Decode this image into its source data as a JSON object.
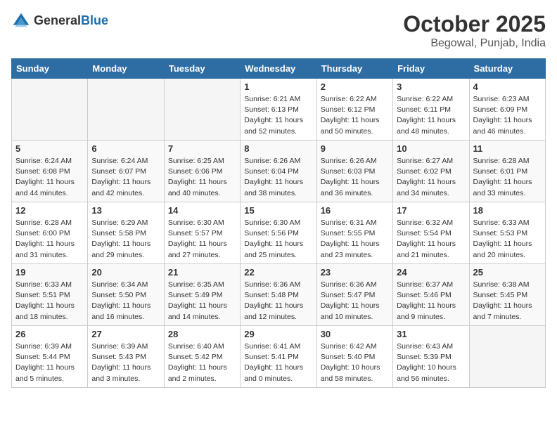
{
  "header": {
    "logo_general": "General",
    "logo_blue": "Blue",
    "month": "October 2025",
    "location": "Begowal, Punjab, India"
  },
  "days_of_week": [
    "Sunday",
    "Monday",
    "Tuesday",
    "Wednesday",
    "Thursday",
    "Friday",
    "Saturday"
  ],
  "weeks": [
    [
      {
        "day": "",
        "info": ""
      },
      {
        "day": "",
        "info": ""
      },
      {
        "day": "",
        "info": ""
      },
      {
        "day": "1",
        "info": "Sunrise: 6:21 AM\nSunset: 6:13 PM\nDaylight: 11 hours\nand 52 minutes."
      },
      {
        "day": "2",
        "info": "Sunrise: 6:22 AM\nSunset: 6:12 PM\nDaylight: 11 hours\nand 50 minutes."
      },
      {
        "day": "3",
        "info": "Sunrise: 6:22 AM\nSunset: 6:11 PM\nDaylight: 11 hours\nand 48 minutes."
      },
      {
        "day": "4",
        "info": "Sunrise: 6:23 AM\nSunset: 6:09 PM\nDaylight: 11 hours\nand 46 minutes."
      }
    ],
    [
      {
        "day": "5",
        "info": "Sunrise: 6:24 AM\nSunset: 6:08 PM\nDaylight: 11 hours\nand 44 minutes."
      },
      {
        "day": "6",
        "info": "Sunrise: 6:24 AM\nSunset: 6:07 PM\nDaylight: 11 hours\nand 42 minutes."
      },
      {
        "day": "7",
        "info": "Sunrise: 6:25 AM\nSunset: 6:06 PM\nDaylight: 11 hours\nand 40 minutes."
      },
      {
        "day": "8",
        "info": "Sunrise: 6:26 AM\nSunset: 6:04 PM\nDaylight: 11 hours\nand 38 minutes."
      },
      {
        "day": "9",
        "info": "Sunrise: 6:26 AM\nSunset: 6:03 PM\nDaylight: 11 hours\nand 36 minutes."
      },
      {
        "day": "10",
        "info": "Sunrise: 6:27 AM\nSunset: 6:02 PM\nDaylight: 11 hours\nand 34 minutes."
      },
      {
        "day": "11",
        "info": "Sunrise: 6:28 AM\nSunset: 6:01 PM\nDaylight: 11 hours\nand 33 minutes."
      }
    ],
    [
      {
        "day": "12",
        "info": "Sunrise: 6:28 AM\nSunset: 6:00 PM\nDaylight: 11 hours\nand 31 minutes."
      },
      {
        "day": "13",
        "info": "Sunrise: 6:29 AM\nSunset: 5:58 PM\nDaylight: 11 hours\nand 29 minutes."
      },
      {
        "day": "14",
        "info": "Sunrise: 6:30 AM\nSunset: 5:57 PM\nDaylight: 11 hours\nand 27 minutes."
      },
      {
        "day": "15",
        "info": "Sunrise: 6:30 AM\nSunset: 5:56 PM\nDaylight: 11 hours\nand 25 minutes."
      },
      {
        "day": "16",
        "info": "Sunrise: 6:31 AM\nSunset: 5:55 PM\nDaylight: 11 hours\nand 23 minutes."
      },
      {
        "day": "17",
        "info": "Sunrise: 6:32 AM\nSunset: 5:54 PM\nDaylight: 11 hours\nand 21 minutes."
      },
      {
        "day": "18",
        "info": "Sunrise: 6:33 AM\nSunset: 5:53 PM\nDaylight: 11 hours\nand 20 minutes."
      }
    ],
    [
      {
        "day": "19",
        "info": "Sunrise: 6:33 AM\nSunset: 5:51 PM\nDaylight: 11 hours\nand 18 minutes."
      },
      {
        "day": "20",
        "info": "Sunrise: 6:34 AM\nSunset: 5:50 PM\nDaylight: 11 hours\nand 16 minutes."
      },
      {
        "day": "21",
        "info": "Sunrise: 6:35 AM\nSunset: 5:49 PM\nDaylight: 11 hours\nand 14 minutes."
      },
      {
        "day": "22",
        "info": "Sunrise: 6:36 AM\nSunset: 5:48 PM\nDaylight: 11 hours\nand 12 minutes."
      },
      {
        "day": "23",
        "info": "Sunrise: 6:36 AM\nSunset: 5:47 PM\nDaylight: 11 hours\nand 10 minutes."
      },
      {
        "day": "24",
        "info": "Sunrise: 6:37 AM\nSunset: 5:46 PM\nDaylight: 11 hours\nand 9 minutes."
      },
      {
        "day": "25",
        "info": "Sunrise: 6:38 AM\nSunset: 5:45 PM\nDaylight: 11 hours\nand 7 minutes."
      }
    ],
    [
      {
        "day": "26",
        "info": "Sunrise: 6:39 AM\nSunset: 5:44 PM\nDaylight: 11 hours\nand 5 minutes."
      },
      {
        "day": "27",
        "info": "Sunrise: 6:39 AM\nSunset: 5:43 PM\nDaylight: 11 hours\nand 3 minutes."
      },
      {
        "day": "28",
        "info": "Sunrise: 6:40 AM\nSunset: 5:42 PM\nDaylight: 11 hours\nand 2 minutes."
      },
      {
        "day": "29",
        "info": "Sunrise: 6:41 AM\nSunset: 5:41 PM\nDaylight: 11 hours\nand 0 minutes."
      },
      {
        "day": "30",
        "info": "Sunrise: 6:42 AM\nSunset: 5:40 PM\nDaylight: 10 hours\nand 58 minutes."
      },
      {
        "day": "31",
        "info": "Sunrise: 6:43 AM\nSunset: 5:39 PM\nDaylight: 10 hours\nand 56 minutes."
      },
      {
        "day": "",
        "info": ""
      }
    ]
  ]
}
